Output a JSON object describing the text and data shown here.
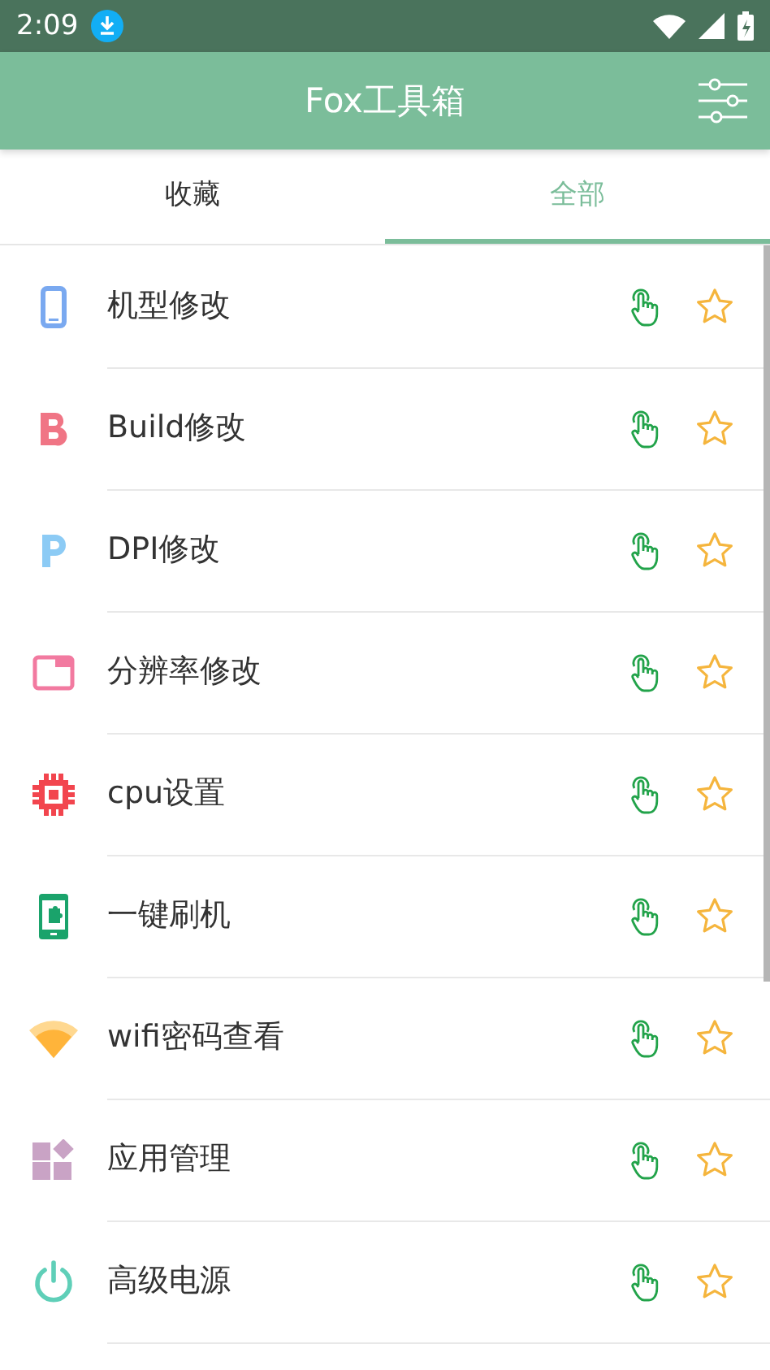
{
  "status_bar": {
    "time": "2:09"
  },
  "app_bar": {
    "title": "Fox工具箱"
  },
  "tabs": [
    {
      "label": "收藏",
      "selected": false
    },
    {
      "label": "全部",
      "selected": true
    }
  ],
  "tools": [
    {
      "kind": "phone",
      "label": "机型修改",
      "favorited": false
    },
    {
      "kind": "letter-b",
      "label": "Build修改",
      "favorited": false
    },
    {
      "kind": "letter-p",
      "label": "DPI修改",
      "favorited": false
    },
    {
      "kind": "window",
      "label": "分辨率修改",
      "favorited": false
    },
    {
      "kind": "chip",
      "label": "cpu设置",
      "favorited": false
    },
    {
      "kind": "flash",
      "label": "一键刷机",
      "favorited": false
    },
    {
      "kind": "wifi",
      "label": "wifi密码查看",
      "favorited": false
    },
    {
      "kind": "apps",
      "label": "应用管理",
      "favorited": false
    },
    {
      "kind": "power",
      "label": "高级电源",
      "favorited": false
    }
  ]
}
